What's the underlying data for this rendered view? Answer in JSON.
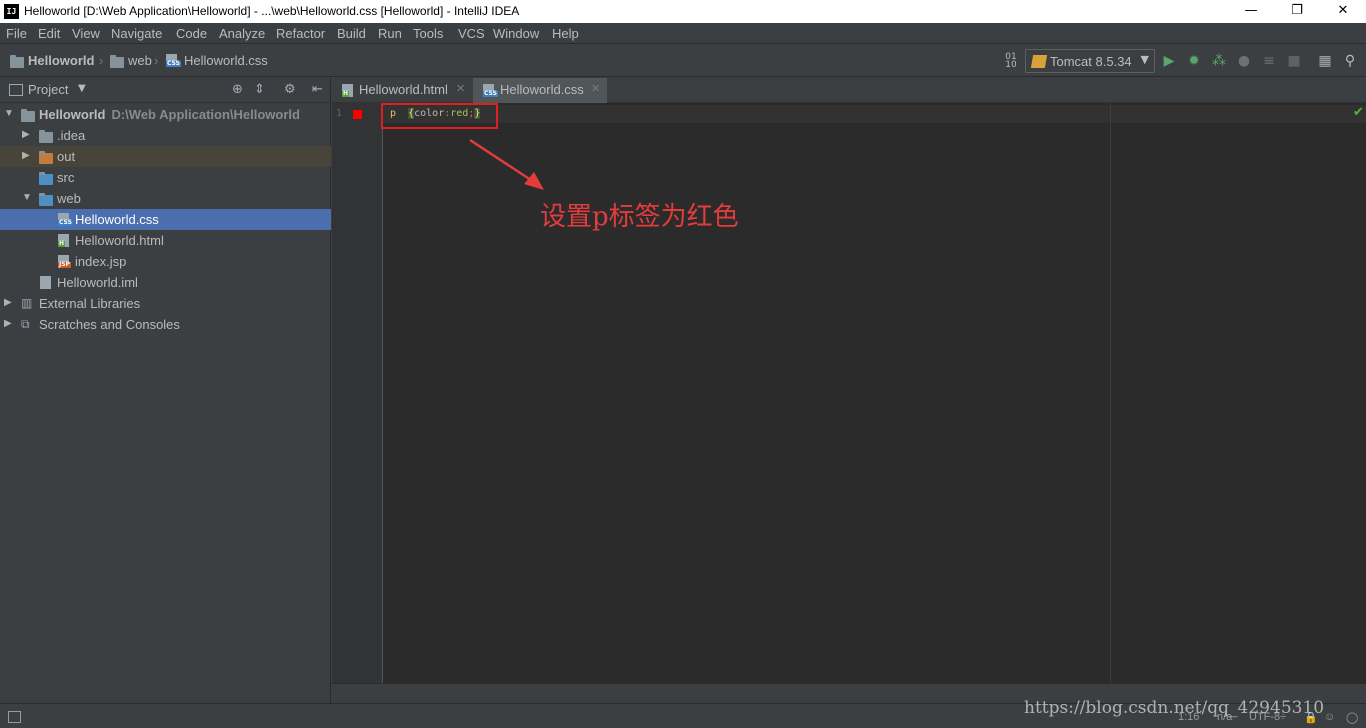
{
  "window": {
    "title": "Helloworld [D:\\Web Application\\Helloworld] - ...\\web\\Helloworld.css [Helloworld] - IntelliJ IDEA",
    "app_icon_label": "IJ",
    "minimize": "—",
    "restore": "❐",
    "close": "✕"
  },
  "menu": [
    "File",
    "Edit",
    "View",
    "Navigate",
    "Code",
    "Analyze",
    "Refactor",
    "Build",
    "Run",
    "Tools",
    "VCS",
    "Window",
    "Help"
  ],
  "breadcrumb": [
    "Helloworld",
    "web",
    "Helloworld.css"
  ],
  "toolbar": {
    "run_config": "Tomcat 8.5.34"
  },
  "project": {
    "header_label": "Project",
    "tree": [
      {
        "label": "Helloworld",
        "sub": "D:\\Web Application\\Helloworld",
        "arrow": "▼"
      },
      {
        "label": ".idea",
        "arrow": "▶"
      },
      {
        "label": "out",
        "arrow": "▶"
      },
      {
        "label": "src",
        "arrow": ""
      },
      {
        "label": "web",
        "arrow": "▼"
      },
      {
        "label": "Helloworld.css",
        "arrow": ""
      },
      {
        "label": "Helloworld.html",
        "arrow": ""
      },
      {
        "label": "index.jsp",
        "arrow": ""
      },
      {
        "label": "Helloworld.iml",
        "arrow": ""
      },
      {
        "label": "External Libraries",
        "arrow": "▶"
      },
      {
        "label": "Scratches and Consoles",
        "arrow": "▶"
      }
    ],
    "selected_index": 5
  },
  "tabs": [
    {
      "label": "Helloworld.html",
      "active": false
    },
    {
      "label": "Helloworld.css",
      "active": true
    }
  ],
  "editor": {
    "line_number": "1",
    "code": {
      "selector": "p",
      "open_brace": "{",
      "property": "color",
      "colon": ":",
      "value": "red",
      "semicolon": ";",
      "close_brace": "}"
    },
    "annotation": "设置p标签为红色"
  },
  "statusbar": {
    "position": "1:16",
    "na": "n/a",
    "encoding": "UTF-8÷"
  },
  "watermark": "https://blog.csdn.net/qq_42945310",
  "colors": {
    "accent_selection": "#4b6eaf",
    "annotation_red": "#e23c3c",
    "editor_bg": "#2b2b2b"
  }
}
